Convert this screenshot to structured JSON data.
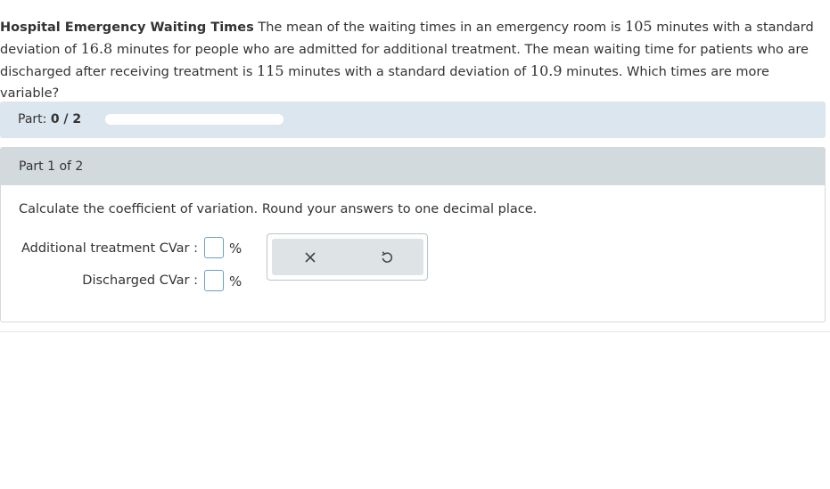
{
  "question": {
    "title": "Hospital Emergency Waiting Times",
    "text_1": " The mean of the waiting times in an emergency room is ",
    "mean_admitted": "105",
    "text_2": " minutes with a standard deviation of ",
    "sd_admitted": "16.8",
    "text_3": " minutes for people who are admitted for additional treatment. The mean waiting time for patients who are discharged after receiving treatment is ",
    "mean_discharged": "115",
    "text_4": " minutes with a standard deviation of ",
    "sd_discharged": "10.9",
    "text_5": " minutes. Which times are more variable?"
  },
  "progress": {
    "label": "Part:",
    "value": "0 / 2",
    "fraction": 0
  },
  "part": {
    "header": "Part 1 of 2",
    "instruction": "Calculate the coefficient of variation. Round your answers to one decimal place."
  },
  "answers": [
    {
      "label": "Additional treatment CVar :",
      "value": "",
      "unit": "%"
    },
    {
      "label": "Discharged CVar :",
      "value": "",
      "unit": "%"
    }
  ],
  "tools": {
    "clear_icon": "close-icon",
    "undo_icon": "undo-icon"
  },
  "colors": {
    "part_bar": "#dce6ee",
    "card_header": "#d3dade",
    "input_border": "#6aa0c8",
    "tool_bg": "#dee3e6"
  }
}
